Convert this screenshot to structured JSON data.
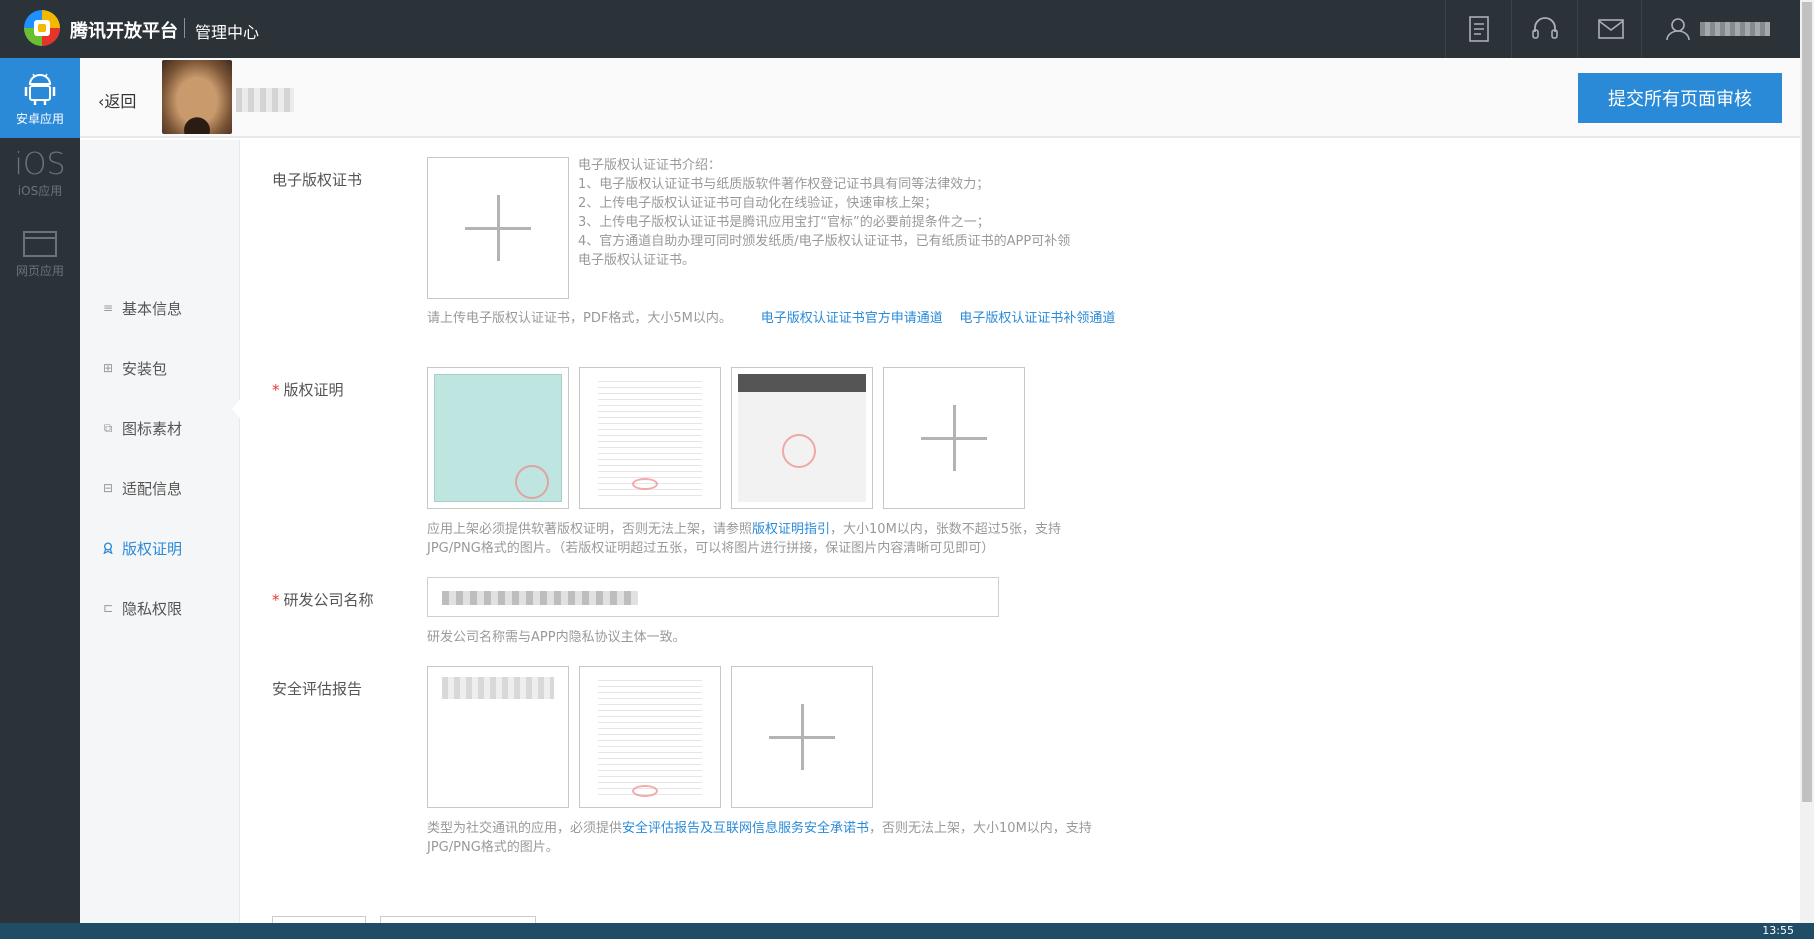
{
  "topbar": {
    "brand": "腾讯开放平台",
    "subtitle": "管理中心",
    "icons": [
      "document-icon",
      "headset-icon",
      "mail-icon",
      "user-icon"
    ]
  },
  "rail": {
    "items": [
      {
        "label": "安卓应用",
        "icon": "android-icon",
        "active": true
      },
      {
        "label": "iOS应用",
        "icon": "ios-icon",
        "active": false
      },
      {
        "label": "网页应用",
        "icon": "webpage-icon",
        "active": false
      }
    ],
    "ios_glyph": "iOS"
  },
  "header": {
    "back_label": "返回",
    "submit_label": "提交所有页面审核"
  },
  "subnav": {
    "items": [
      {
        "label": "基本信息",
        "icon": "≡"
      },
      {
        "label": "安装包",
        "icon": "⊞"
      },
      {
        "label": "图标素材",
        "icon": "⧉"
      },
      {
        "label": "适配信息",
        "icon": "⊟"
      },
      {
        "label": "版权证明",
        "icon": "ribbon"
      },
      {
        "label": "隐私权限",
        "icon": "⊏"
      }
    ],
    "active_index": 4
  },
  "ecert": {
    "label": "电子版权证书",
    "intro": [
      "电子版权认证证书介绍：",
      "1、电子版权认证证书与纸质版软件著作权登记证书具有同等法律效力；",
      "2、上传电子版权认证证书可自动化在线验证，快速审核上架；",
      "3、上传电子版权认证证书是腾讯应用宝打“官标”的必要前提条件之一；",
      "4、官方通道自助办理可同时颁发纸质/电子版权认证证书，已有纸质证书的APP可补领",
      "电子版权认证证书。"
    ],
    "hint": "请上传电子版权认证证书，PDF格式，大小5M以内。",
    "link1": "电子版权认证证书官方申请通道",
    "link2": "电子版权认证证书补领通道"
  },
  "copyright": {
    "label": "版权证明",
    "required_mark": "*",
    "hint_pre": "应用上架必须提供软著版权证明，否则无法上架，请参照",
    "hint_link": "版权证明指引",
    "hint_post": "，大小10M以内，张数不超过5张，支持",
    "hint_line2": "JPG/PNG格式的图片。（若版权证明超过五张，可以将图片进行拼接，保证图片内容清晰可见即可）"
  },
  "company": {
    "label": "研发公司名称",
    "required_mark": "*",
    "hint": "研发公司名称需与APP内隐私协议主体一致。"
  },
  "security": {
    "label": "安全评估报告",
    "hint_pre": "类型为社交通讯的应用，必须提供",
    "hint_link": "安全评估报告及互联网信息服务安全承诺书",
    "hint_post": "，否则无法上架，大小10M以内，支持",
    "hint_line2": "JPG/PNG格式的图片。"
  },
  "taskbar": {
    "time": "13:55"
  }
}
